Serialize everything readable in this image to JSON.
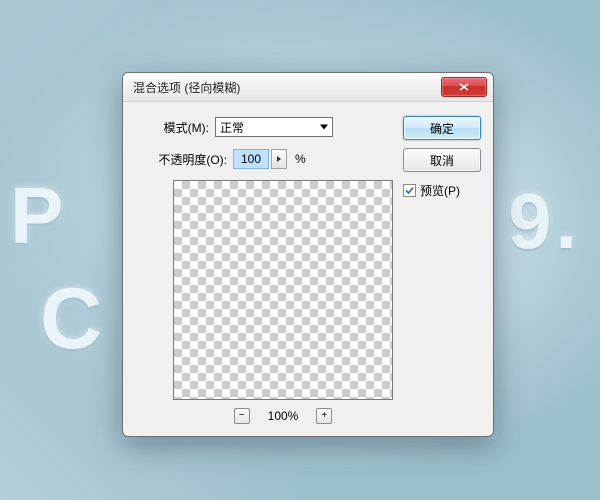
{
  "bg_text": {
    "line1": "P",
    "line2": "9.",
    "line3": "C"
  },
  "dialog": {
    "title": "混合选项 (径向模糊)",
    "mode_label": "模式(M):",
    "mode_value": "正常",
    "opacity_label": "不透明度(O):",
    "opacity_value": "100",
    "opacity_suffix": "%",
    "ok_label": "确定",
    "cancel_label": "取消",
    "preview_label": "预览(P)",
    "zoom_value": "100%",
    "zoom_out_glyph": "−",
    "zoom_in_glyph": "+"
  }
}
